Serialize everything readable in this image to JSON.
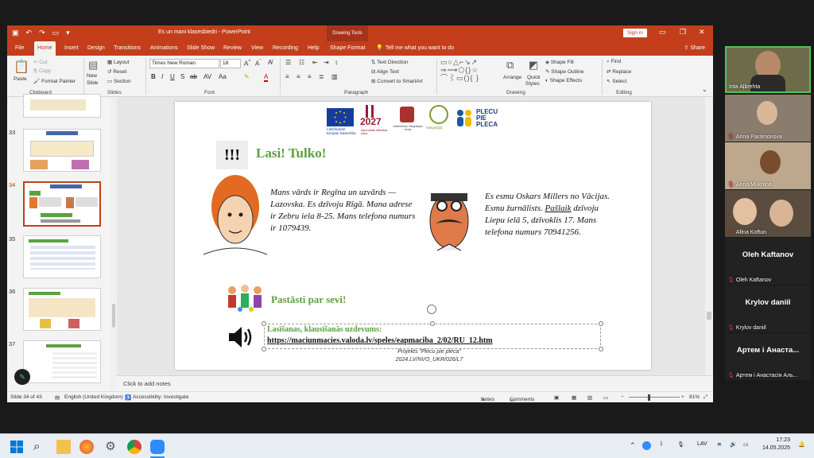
{
  "window": {
    "doc_title": "Es un mani klasesbiedri - PowerPoint",
    "context_label": "Drawing Tools",
    "sign_in": "Sign in"
  },
  "tabs": [
    "File",
    "Home",
    "Insert",
    "Design",
    "Transitions",
    "Animations",
    "Slide Show",
    "Review",
    "View",
    "Recording",
    "Help",
    "Shape Format"
  ],
  "tell_me": "Tell me what you want to do",
  "share": "Share",
  "ribbon": {
    "clipboard": {
      "paste": "Paste",
      "cut": "Cut",
      "copy": "Copy",
      "format_painter": "Format Painter",
      "group": "Clipboard"
    },
    "slides": {
      "new_slide_1": "New",
      "new_slide_2": "Slide",
      "layout": "Layout",
      "reset": "Reset",
      "section": "Section",
      "group": "Slides"
    },
    "font": {
      "family": "Times New Roman",
      "size": "18",
      "group": "Font"
    },
    "paragraph": {
      "text_direction": "Text Direction",
      "align_text": "Align Text",
      "smartart": "Convert to SmartArt",
      "group": "Paragraph"
    },
    "drawing": {
      "arrange": "Arrange",
      "quick_styles_1": "Quick",
      "quick_styles_2": "Styles",
      "shape_fill": "Shape Fill",
      "shape_outline": "Shape Outline",
      "shape_effects": "Shape Effects",
      "group": "Drawing"
    },
    "editing": {
      "find": "Find",
      "replace": "Replace",
      "select": "Select",
      "group": "Editing"
    }
  },
  "thumbnails": [
    {
      "num": "33",
      "selected": false
    },
    {
      "num": "34",
      "selected": true
    },
    {
      "num": "35",
      "selected": false
    },
    {
      "num": "36",
      "selected": false
    },
    {
      "num": "37",
      "selected": false
    }
  ],
  "slide": {
    "logo_eu_1": "Eiropas Savienība",
    "logo_eu_2": "Līdzfinansē",
    "logo_2027": "2027",
    "logo_2027_sub": "Nacionālais attīstības plāns",
    "logo_sif": "Sabiedrības integrācijas fonds",
    "logo_int": "integrācija",
    "logo_plecu": [
      "PLECU",
      "PIE",
      "PLECA"
    ],
    "exclaim_icon": "!!!",
    "heading1": "Lasi! Tulko!",
    "regina_text": "Mans vārds ir Regīna un uzvārds — Lazovska. Es dzīvoju Rīgā. Mana adrese ir Zebru iela 8-25. Mans telefona numurs ir 1079439.",
    "oskars_line1": "Es esmu Oskars Millers no Vācijas.",
    "oskars_line2a": "Esmu žurnālists.",
    "oskars_underlined": "Pašlaik",
    "oskars_line2b": " dzīvoju",
    "oskars_line3": "Liepu ielā 5, dzīvoklis 17. Mans",
    "oskars_line4": "telefona numurs 70941256.",
    "heading2": "Pastāsti par sevi!",
    "task_label": "Lasīšanas, klausīšanās uzdevums:",
    "task_link": "https://maciunmacies.valoda.lv/speles/eapmaciba_2/02/RU_12.htm",
    "caption_1": "Projekts \"Plecu pie pleca\"",
    "caption_2": "2024.LV/NVO_UKR/026/L7"
  },
  "notes_placeholder": "Click to add notes",
  "status": {
    "slide_of": "Slide 34 of 43",
    "language": "English (United Kingdom)",
    "accessibility": "Accessibility: Investigate",
    "notes": "Notes",
    "comments": "Comments",
    "zoom": "81%"
  },
  "participants": [
    {
      "name": "Inta Aļbrehta",
      "video": true,
      "muted": false
    },
    {
      "name": "Arina Paramonova",
      "video": true,
      "muted": true
    },
    {
      "name": "Arina Mukhina",
      "video": true,
      "muted": false
    },
    {
      "name": "Afina Koftun",
      "video": true,
      "muted": true
    },
    {
      "big": "Oleh Kaftanov",
      "name": "Oleh Kaftanov",
      "video": false,
      "muted": true
    },
    {
      "big": "Krylov daniil",
      "name": "Krylov daniil",
      "video": false,
      "muted": true
    },
    {
      "big": "Артем і Анаста...",
      "name": "Артем і Анастасія Аль...",
      "video": false,
      "muted": true
    }
  ],
  "taskbar": {
    "lang": "LAV",
    "time": "17:23",
    "date": "14.05.2025"
  },
  "colors": {
    "ppt_accent": "#c43e1c",
    "slide_green": "#5ba13f"
  }
}
